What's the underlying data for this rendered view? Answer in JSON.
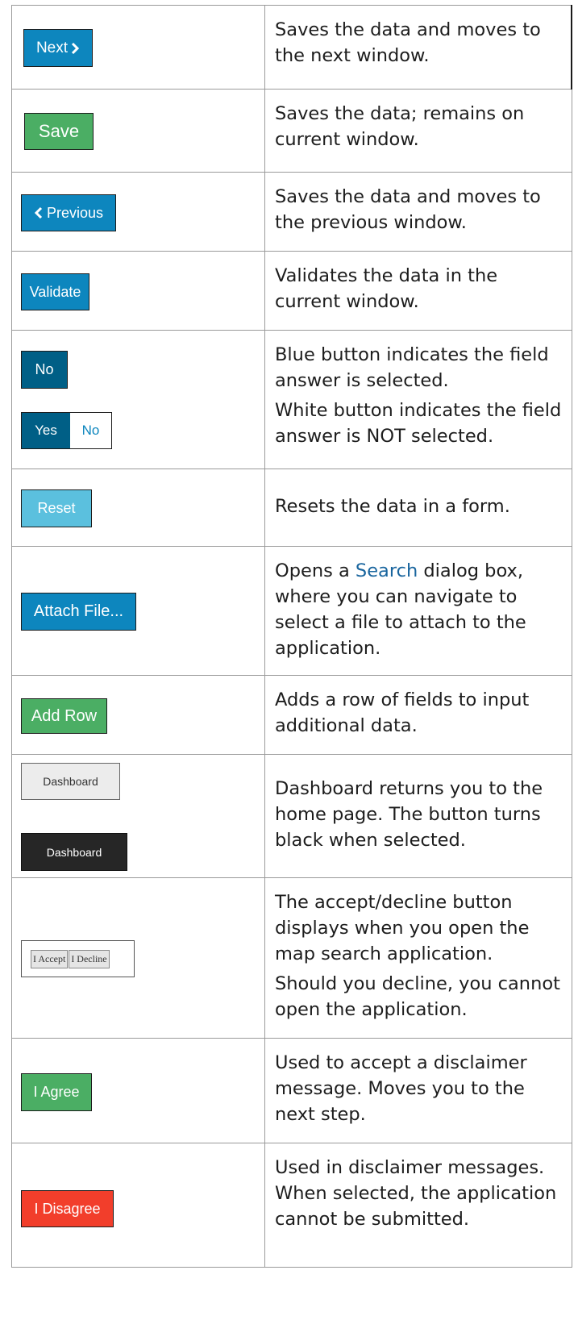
{
  "rows": [
    {
      "buttons": [
        "Next"
      ],
      "description": [
        "Saves the data and moves to the next window."
      ]
    },
    {
      "buttons": [
        "Save"
      ],
      "description": [
        "Saves the data; remains on current window."
      ]
    },
    {
      "buttons": [
        "Previous"
      ],
      "description": [
        "Saves the data and moves to the previous window."
      ]
    },
    {
      "buttons": [
        "Validate"
      ],
      "description": [
        "Validates the data in the current window."
      ]
    },
    {
      "buttons": [
        "No",
        "Yes",
        "No"
      ],
      "description": [
        "Blue button indicates the field answer is selected.",
        "White button indicates the field answer is NOT selected."
      ]
    },
    {
      "buttons": [
        "Reset"
      ],
      "description": [
        "Resets the data in a form."
      ]
    },
    {
      "buttons": [
        "Attach File..."
      ],
      "description_before": "Opens a ",
      "description_link": "Search",
      "description_after": " dialog box, where you can navigate to select a file to attach to the application."
    },
    {
      "buttons": [
        "Add Row"
      ],
      "description": [
        "Adds a row of fields to input additional data."
      ]
    },
    {
      "buttons": [
        "Dashboard",
        "Dashboard"
      ],
      "description": [
        "Dashboard returns you to the home page. The button turns black when selected."
      ]
    },
    {
      "buttons": [
        "I Accept",
        "I Decline"
      ],
      "description": [
        "The accept/decline button displays when you open the map search application.",
        "Should you decline, you cannot open the application."
      ]
    },
    {
      "buttons": [
        "I Agree"
      ],
      "description": [
        "Used to accept a disclaimer message. Moves you to the next step."
      ]
    },
    {
      "buttons": [
        "I Disagree"
      ],
      "description": [
        "Used in disclaimer messages. When selected, the application cannot be submitted."
      ]
    }
  ],
  "colors": {
    "primary_blue": "#0d86be",
    "selected_dark_blue": "#005f86",
    "reset_light_blue": "#5bc0de",
    "green": "#4bae64",
    "disagree_red": "#f23e2b",
    "dashboard_black": "#262626",
    "link_blue": "#19659e"
  },
  "icons": [
    "chevron-right-icon",
    "chevron-left-icon"
  ]
}
